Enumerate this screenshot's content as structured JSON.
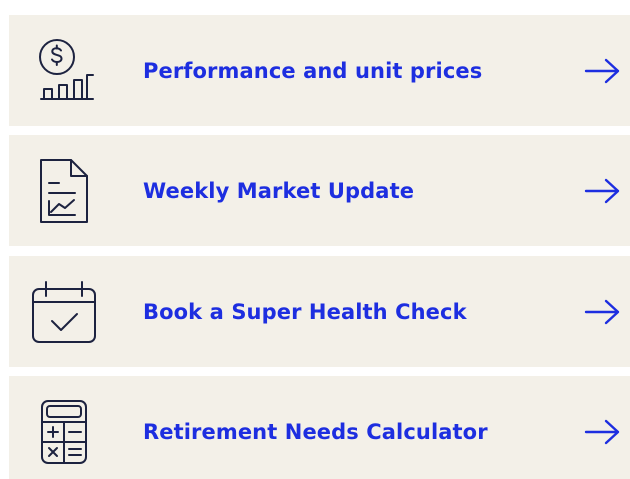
{
  "colors": {
    "card_background": "#f3f0e8",
    "link_text": "#1d2ee0",
    "icon_stroke": "#1d2340"
  },
  "links": [
    {
      "label": "Performance and unit prices",
      "icon": "dollar-bar-chart-icon"
    },
    {
      "label": "Weekly Market Update",
      "icon": "document-chart-icon"
    },
    {
      "label": "Book a Super Health Check",
      "icon": "calendar-check-icon"
    },
    {
      "label": "Retirement Needs Calculator",
      "icon": "calculator-icon"
    }
  ]
}
